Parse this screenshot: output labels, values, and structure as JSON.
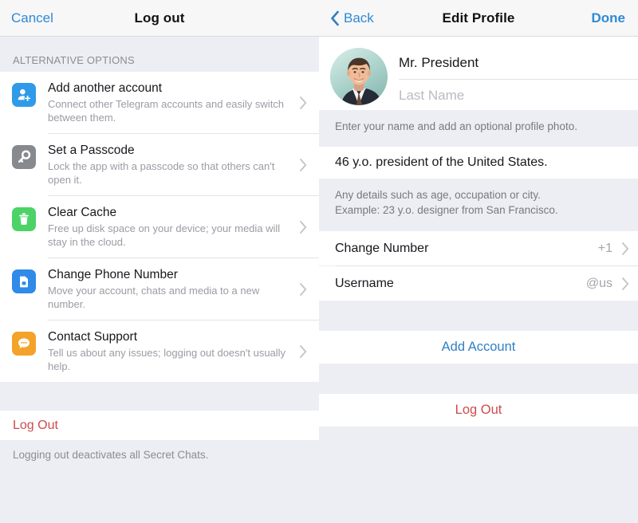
{
  "left_panel": {
    "navbar": {
      "cancel_label": "Cancel",
      "title": "Log out"
    },
    "section_header": "ALTERNATIVE OPTIONS",
    "options": [
      {
        "title": "Add another account",
        "subtitle": "Connect other Telegram accounts and easily switch between them.",
        "icon": "add-user-icon",
        "icon_color": "#2f9ae8"
      },
      {
        "title": "Set a Passcode",
        "subtitle": "Lock the app with a passcode so that others can't open it.",
        "icon": "key-icon",
        "icon_color": "#868a8f"
      },
      {
        "title": "Clear Cache",
        "subtitle": "Free up disk space on your device; your media will stay in the cloud.",
        "icon": "trash-icon",
        "icon_color": "#4bd367"
      },
      {
        "title": "Change Phone Number",
        "subtitle": "Move your account, chats and media to a new number.",
        "icon": "sim-card-icon",
        "icon_color": "#2f8ae8"
      },
      {
        "title": "Contact Support",
        "subtitle": "Tell us about any issues; logging out doesn't usually help.",
        "icon": "chat-bubble-icon",
        "icon_color": "#f3a32a"
      }
    ],
    "logout_label": "Log Out",
    "footer_note": "Logging out deactivates all Secret Chats."
  },
  "right_panel": {
    "navbar": {
      "back_label": "Back",
      "title": "Edit Profile",
      "done_label": "Done"
    },
    "profile": {
      "avatar_name": "profile-photo",
      "first_name_value": "Mr. President",
      "last_name_placeholder": "Last Name",
      "name_hint": "Enter your name and add an optional profile photo."
    },
    "bio": {
      "value": "46 y.o. president of the United States.",
      "hint_line1": "Any details such as age, occupation or city.",
      "hint_line2": "Example: 23 y.o. designer from San Francisco."
    },
    "menu": [
      {
        "label": "Change Number",
        "value": "+1"
      },
      {
        "label": "Username",
        "value": "@us"
      }
    ],
    "add_account_label": "Add Account",
    "logout_label": "Log Out"
  },
  "colors": {
    "accent_blue": "#2f8ad4",
    "destructive_red": "#cc4c4c",
    "group_background": "#eceef4",
    "row_background": "#ffffff"
  }
}
